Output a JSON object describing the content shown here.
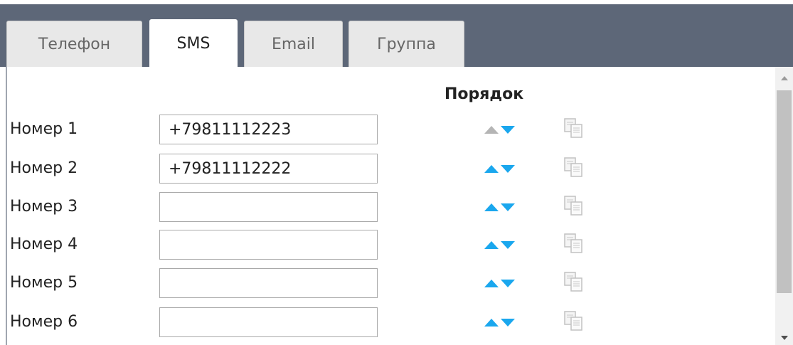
{
  "tabs": [
    {
      "label": "Телефон",
      "active": false
    },
    {
      "label": "SMS",
      "active": true
    },
    {
      "label": "Email",
      "active": false
    },
    {
      "label": "Группа",
      "active": false
    }
  ],
  "order_header": "Порядок",
  "rows": [
    {
      "label": "Номер 1",
      "value": "+79811112223",
      "up_disabled": true
    },
    {
      "label": "Номер 2",
      "value": "+79811112222",
      "up_disabled": false
    },
    {
      "label": "Номер 3",
      "value": "",
      "up_disabled": false
    },
    {
      "label": "Номер 4",
      "value": "",
      "up_disabled": false
    },
    {
      "label": "Номер 5",
      "value": "",
      "up_disabled": false
    },
    {
      "label": "Номер 6",
      "value": "",
      "up_disabled": false
    }
  ],
  "icons": {
    "move_up": "arrow-up-icon",
    "move_down": "arrow-down-icon",
    "copy": "copy-icon"
  },
  "colors": {
    "tabbar": "#5d6778",
    "arrow": "#1aa7ee",
    "arrow_disabled": "#b5b5b5"
  }
}
